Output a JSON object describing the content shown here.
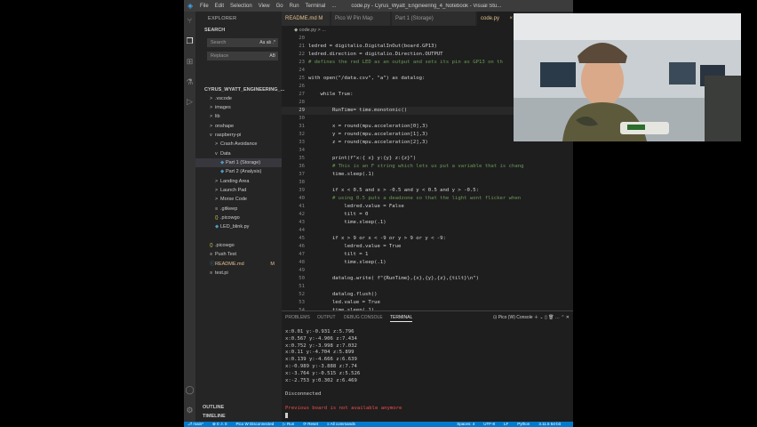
{
  "window": {
    "menus": [
      "File",
      "Edit",
      "Selection",
      "View",
      "Go",
      "Run",
      "Terminal",
      "..."
    ],
    "title": "code.py - Cyrus_Wyatt_Engineering_4_Notebook - Visual Stu..."
  },
  "sidebar": {
    "header": "EXPLORER",
    "search_title": "SEARCH",
    "search_placeholder": "Search",
    "search_opts": "Aa ab .*",
    "replace_placeholder": "Replace",
    "replace_opt": "AB",
    "project_title": "CYRUS_WYATT_ENGINEERING_...",
    "items": [
      {
        "label": ".vscode",
        "icon": ">"
      },
      {
        "label": "images",
        "icon": ">"
      },
      {
        "label": "lib",
        "icon": ">"
      },
      {
        "label": "onshape",
        "icon": ">"
      },
      {
        "label": "raspberry-pi",
        "icon": "v"
      },
      {
        "label": "Crash Avoidance",
        "icon": ">"
      },
      {
        "label": "Data",
        "icon": "v"
      },
      {
        "label": "Part 1 (Storage)",
        "icon": "◆"
      },
      {
        "label": "Part 2 (Analysis)",
        "icon": "◆"
      },
      {
        "label": "Landing Area",
        "icon": ">"
      },
      {
        "label": "Launch Pad",
        "icon": ">"
      },
      {
        "label": "Morse Code",
        "icon": ">"
      },
      {
        "label": ".gitkeep",
        "icon": "≡"
      },
      {
        "label": ".picowgo",
        "icon": "{}"
      },
      {
        "label": "LED_blink.py",
        "icon": "◆"
      },
      {
        "label": ".picowgo",
        "icon": "{}"
      },
      {
        "label": "Push Test",
        "icon": "≡"
      },
      {
        "label": "README.md",
        "icon": "ⓘ",
        "badge": "M"
      },
      {
        "label": "test.pi",
        "icon": "≡"
      }
    ],
    "outline": "OUTLINE",
    "timeline": "TIMELINE"
  },
  "tabs": [
    {
      "label": "README.md",
      "badge": "M"
    },
    {
      "label": "Pico W Pin Map",
      "badge": ""
    },
    {
      "label": "Part 1 (Storage)",
      "badge": ""
    },
    {
      "label": "code.py",
      "badge": "×"
    }
  ],
  "breadcrumb": "◆ code.py > ...",
  "code_lines": [
    {
      "n": "20",
      "t": "",
      "c": ""
    },
    {
      "n": "21",
      "t": "ledred = digitalio.DigitalInOut(board.GP13)",
      "c": ""
    },
    {
      "n": "22",
      "t": "ledred.direction = digitalio.Direction.OUTPUT",
      "c": ""
    },
    {
      "n": "23",
      "t": "# defines the red LED as an output and sets its pin as GP13 on th",
      "c": "comment"
    },
    {
      "n": "24",
      "t": "",
      "c": ""
    },
    {
      "n": "25",
      "t": "with open(\"/data.csv\", \"a\") as datalog:",
      "c": ""
    },
    {
      "n": "26",
      "t": "",
      "c": ""
    },
    {
      "n": "27",
      "t": "    while True:",
      "c": ""
    },
    {
      "n": "28",
      "t": "",
      "c": ""
    },
    {
      "n": "29",
      "t": "        RunTime= time.monotonic()",
      "c": "cur"
    },
    {
      "n": "30",
      "t": "",
      "c": ""
    },
    {
      "n": "31",
      "t": "        x = round(mpu.acceleration[0],3)",
      "c": ""
    },
    {
      "n": "32",
      "t": "        y = round(mpu.acceleration[1],3)",
      "c": ""
    },
    {
      "n": "33",
      "t": "        z = round(mpu.acceleration[2],3)",
      "c": ""
    },
    {
      "n": "34",
      "t": "",
      "c": ""
    },
    {
      "n": "35",
      "t": "        print(f\"x:{ x} y:{y} z:{z}\")",
      "c": ""
    },
    {
      "n": "36",
      "t": "        # This is an F string which lets us put a variable that is chang",
      "c": "comment"
    },
    {
      "n": "37",
      "t": "        time.sleep(.1)",
      "c": ""
    },
    {
      "n": "38",
      "t": "",
      "c": ""
    },
    {
      "n": "39",
      "t": "        if x < 0.5 and x > -0.5 and y < 0.5 and y > -0.5:",
      "c": ""
    },
    {
      "n": "40",
      "t": "        # using 0.5 puts a deadzone so that the light wont flicker when",
      "c": "comment"
    },
    {
      "n": "41",
      "t": "            ledred.value = False",
      "c": ""
    },
    {
      "n": "42",
      "t": "            tilt = 0",
      "c": ""
    },
    {
      "n": "43",
      "t": "            time.sleep(.1)",
      "c": ""
    },
    {
      "n": "44",
      "t": "",
      "c": ""
    },
    {
      "n": "45",
      "t": "        if x > 9 or x < -9 or y > 9 or y < -9:",
      "c": ""
    },
    {
      "n": "46",
      "t": "            ledred.value = True",
      "c": ""
    },
    {
      "n": "47",
      "t": "            tilt = 1",
      "c": ""
    },
    {
      "n": "48",
      "t": "            time.sleep(.1)",
      "c": ""
    },
    {
      "n": "49",
      "t": "",
      "c": ""
    },
    {
      "n": "50",
      "t": "        datalog.write( f\"{RunTime},{x},{y},{z},{tilt}\\n\")",
      "c": ""
    },
    {
      "n": "51",
      "t": "",
      "c": ""
    },
    {
      "n": "52",
      "t": "        datalog.flush()",
      "c": ""
    },
    {
      "n": "53",
      "t": "        led.value = True",
      "c": ""
    },
    {
      "n": "54",
      "t": "        time.sleep(.1)",
      "c": ""
    }
  ],
  "panel": {
    "tabs": [
      "PROBLEMS",
      "OUTPUT",
      "DEBUG CONSOLE",
      "TERMINAL"
    ],
    "active_tab": "TERMINAL",
    "console_name": "Pico (W) Console",
    "lines": [
      {
        "t": "x:0.01 y:-0.931 z:5.796",
        "c": ""
      },
      {
        "t": "x:0.567 y:-4.906 z:7.434",
        "c": ""
      },
      {
        "t": "x:0.752 y:-3.998 z:7.032",
        "c": ""
      },
      {
        "t": "x:0.11 y:-4.704 z:5.899",
        "c": ""
      },
      {
        "t": "x:0.139 y:-4.666 z:6.639",
        "c": ""
      },
      {
        "t": "x:-0.989 y:-3.888 z:7.74",
        "c": ""
      },
      {
        "t": "x:-3.764 y:-0.515 z:5.526",
        "c": ""
      },
      {
        "t": "x:-2.753 y:0.302 z:6.469",
        "c": ""
      },
      {
        "t": "",
        "c": ""
      },
      {
        "t": "Disconnected",
        "c": ""
      },
      {
        "t": "",
        "c": ""
      },
      {
        "t": "Previous board is not available anymore",
        "c": "err"
      }
    ]
  },
  "status": {
    "left": [
      "⎇ main*",
      "⊗ 0 ⚠ 0",
      "Pico W Disconnected",
      "▷ Run",
      "⟳ Reset",
      "≡ All commands"
    ],
    "right": [
      "Spaces: 4",
      "UTF-8",
      "LF",
      "Python",
      "3.11.5 64-bit"
    ]
  },
  "colors": {
    "accent": "#007acc",
    "error": "#f14c4c",
    "comment": "#6a9955"
  }
}
